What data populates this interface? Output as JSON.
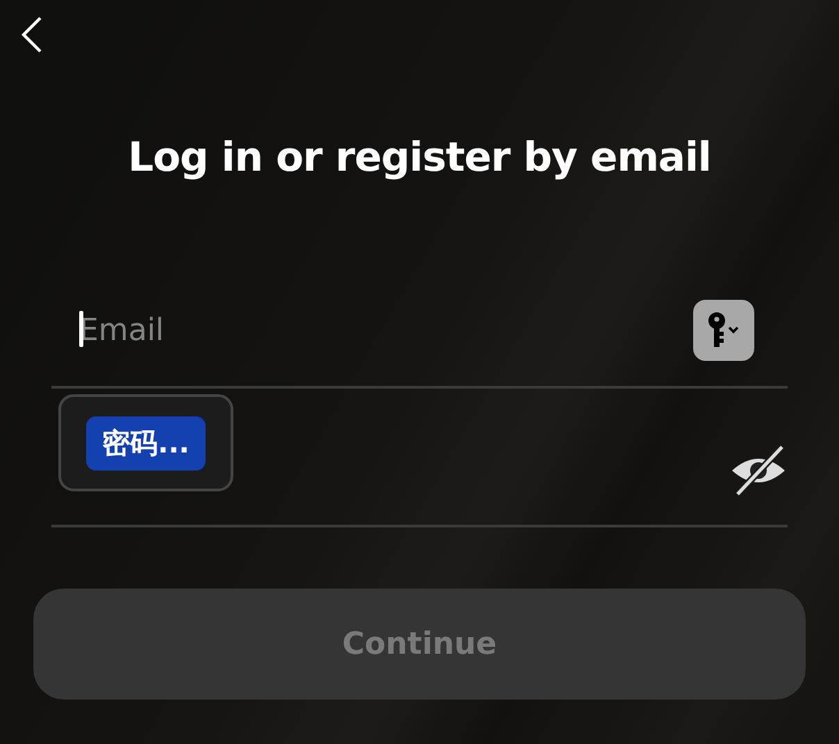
{
  "title": "Log in or register by email",
  "email_field": {
    "placeholder": "Email",
    "focused": true
  },
  "password_field": {
    "revealed": false,
    "autofill_popup": {
      "label": "密码..."
    }
  },
  "continue_button": {
    "label": "Continue",
    "disabled": true
  }
}
